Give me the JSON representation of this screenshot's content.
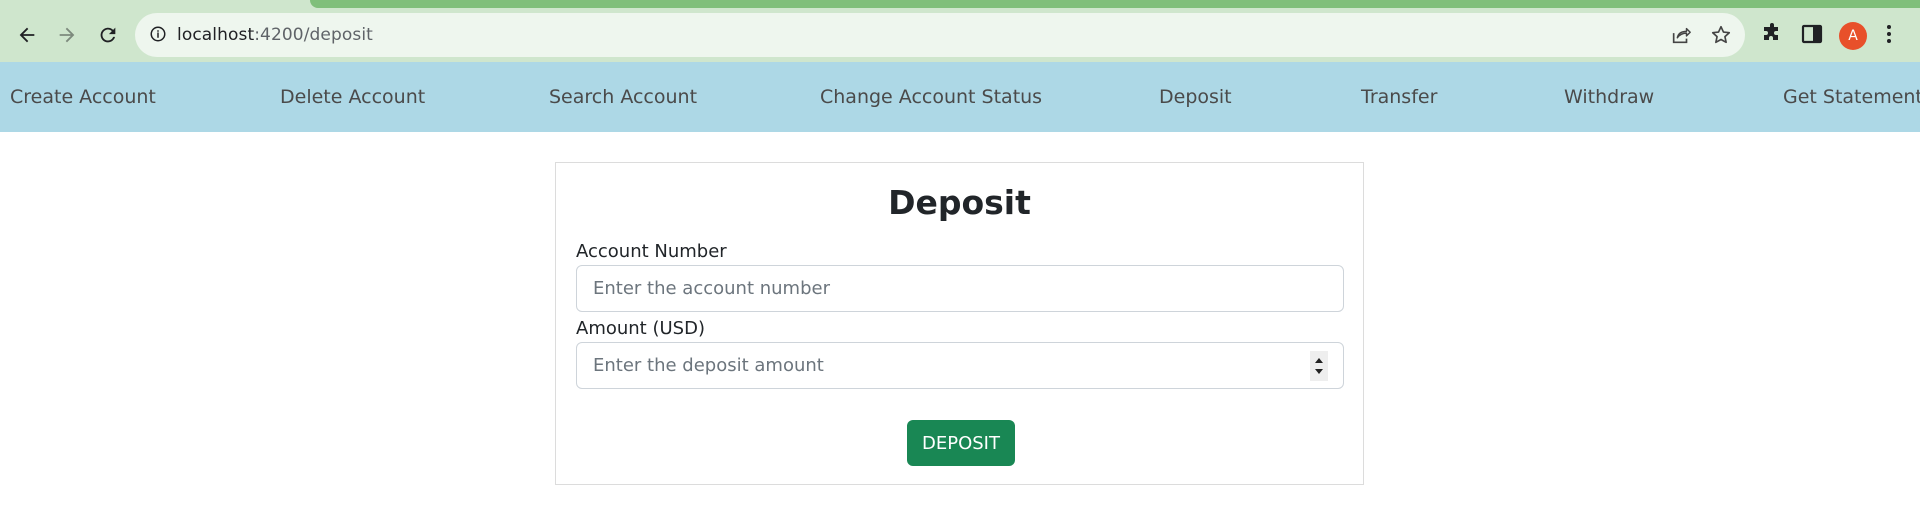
{
  "browser": {
    "url_host": "localhost",
    "url_path": ":4200/deposit",
    "profile_initial": "A",
    "icons": [
      "back-arrow-icon",
      "forward-arrow-icon",
      "reload-icon",
      "info-icon",
      "share-icon",
      "star-icon",
      "extensions-icon",
      "side-panel-icon",
      "menu-dots-icon"
    ],
    "colors": {
      "tab_strip": "#80bf7b",
      "chrome_bg": "#cfe6cd",
      "omnibox_bg": "#eef6ee",
      "avatar": "#e8502a"
    }
  },
  "navbar": {
    "items": [
      {
        "label": "Create Account"
      },
      {
        "label": "Delete Account"
      },
      {
        "label": "Search Account"
      },
      {
        "label": "Change Account Status"
      },
      {
        "label": "Deposit"
      },
      {
        "label": "Transfer"
      },
      {
        "label": "Withdraw"
      },
      {
        "label": "Get Statement"
      }
    ],
    "bg_color": "#add8e6"
  },
  "form": {
    "title": "Deposit",
    "account_label": "Account Number",
    "account_placeholder": "Enter the account number",
    "account_value": "",
    "amount_label": "Amount (USD)",
    "amount_placeholder": "Enter the deposit amount",
    "amount_value": "",
    "submit_label": "DEPOSIT",
    "submit_color": "#198754"
  }
}
